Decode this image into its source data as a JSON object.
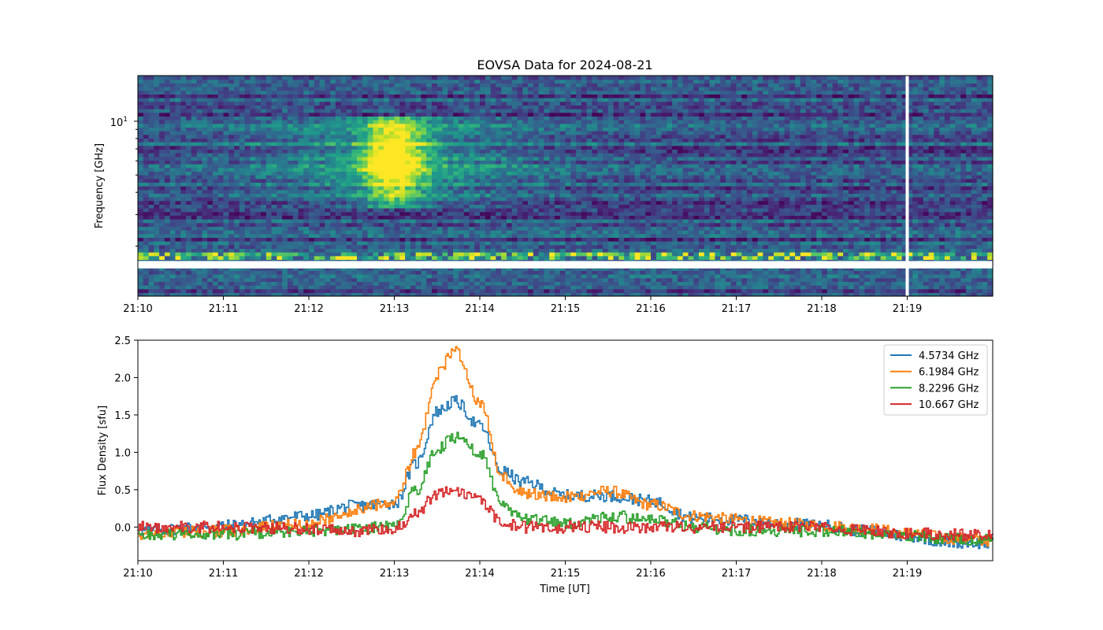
{
  "figure": {
    "title": "EOVSA Data for 2024-08-21"
  },
  "spectrogram": {
    "ylabel": "Frequency [GHz]",
    "ytick_label": "10",
    "ytick_exp": "1",
    "xticks": [
      "21:10",
      "21:11",
      "21:12",
      "21:13",
      "21:14",
      "21:15",
      "21:16",
      "21:17",
      "21:18",
      "21:19"
    ],
    "colormap": "viridis",
    "yscale": "log"
  },
  "chart_data": [
    {
      "type": "heatmap",
      "title": "EOVSA Data for 2024-08-21",
      "ylabel": "Frequency [GHz]",
      "yscale": "log",
      "ylim": [
        1.05,
        18
      ],
      "xlim": [
        "21:10",
        "21:20"
      ],
      "colormap": "viridis",
      "features": {
        "burst_peak_time": "21:13:40",
        "burst_freq_range_GHz": [
          3.3,
          10.5
        ],
        "data_gap_freq_GHz": [
          1.5,
          1.65
        ],
        "data_gap_time": "21:19:18"
      }
    },
    {
      "type": "line",
      "xlabel": "Time [UT]",
      "ylabel": "Flux Density [sfu]",
      "xlim": [
        "21:10",
        "21:20"
      ],
      "ylim": [
        -0.45,
        2.5
      ],
      "yticks": [
        "0.0",
        "0.5",
        "1.0",
        "1.5",
        "2.0",
        "2.5"
      ],
      "xticks": [
        "21:10",
        "21:11",
        "21:12",
        "21:13",
        "21:14",
        "21:15",
        "21:16",
        "21:17",
        "21:18",
        "21:19"
      ],
      "legend_position": "top-right",
      "x": [
        "21:10",
        "21:11",
        "21:12",
        "21:12.5",
        "21:13",
        "21:13.25",
        "21:13.5",
        "21:13.7",
        "21:14",
        "21:14.25",
        "21:14.5",
        "21:15",
        "21:15.5",
        "21:16",
        "21:16.5",
        "21:17",
        "21:17.5",
        "21:18",
        "21:18.5",
        "21:19",
        "21:19.5",
        "21:20"
      ],
      "series": [
        {
          "name": "4.5734 GHz",
          "color": "#1f77b4",
          "values": [
            -0.05,
            0.02,
            0.15,
            0.28,
            0.32,
            0.85,
            1.55,
            1.68,
            1.35,
            0.75,
            0.6,
            0.42,
            0.42,
            0.35,
            0.12,
            0.1,
            0.05,
            0.02,
            -0.05,
            -0.12,
            -0.2,
            -0.22
          ]
        },
        {
          "name": "6.1984 GHz",
          "color": "#ff7f0e",
          "values": [
            -0.1,
            -0.05,
            0.05,
            0.22,
            0.35,
            1.0,
            2.05,
            2.38,
            1.65,
            0.7,
            0.45,
            0.4,
            0.48,
            0.3,
            0.15,
            0.1,
            0.05,
            0.02,
            -0.02,
            -0.08,
            -0.15,
            -0.18
          ]
        },
        {
          "name": "8.2296 GHz",
          "color": "#2ca02c",
          "values": [
            -0.1,
            -0.1,
            -0.05,
            -0.02,
            0.02,
            0.5,
            1.05,
            1.2,
            1.0,
            0.3,
            0.1,
            0.05,
            0.15,
            0.1,
            0.0,
            -0.05,
            -0.05,
            -0.05,
            -0.08,
            -0.12,
            -0.15,
            -0.18
          ]
        },
        {
          "name": "10.667 GHz",
          "color": "#d62728",
          "values": [
            0.0,
            0.0,
            -0.02,
            -0.05,
            -0.02,
            0.2,
            0.45,
            0.5,
            0.35,
            0.05,
            0.0,
            0.0,
            0.0,
            0.0,
            0.0,
            0.0,
            0.0,
            0.0,
            -0.05,
            -0.08,
            -0.1,
            -0.12
          ]
        }
      ]
    }
  ],
  "lightcurve": {
    "xlabel": "Time [UT]",
    "ylabel": "Flux Density [sfu]",
    "yticks": [
      "0.0",
      "0.5",
      "1.0",
      "1.5",
      "2.0",
      "2.5"
    ],
    "xticks": [
      "21:10",
      "21:11",
      "21:12",
      "21:13",
      "21:14",
      "21:15",
      "21:16",
      "21:17",
      "21:18",
      "21:19"
    ],
    "legend": [
      "4.5734 GHz",
      "6.1984 GHz",
      "8.2296 GHz",
      "10.667 GHz"
    ]
  }
}
